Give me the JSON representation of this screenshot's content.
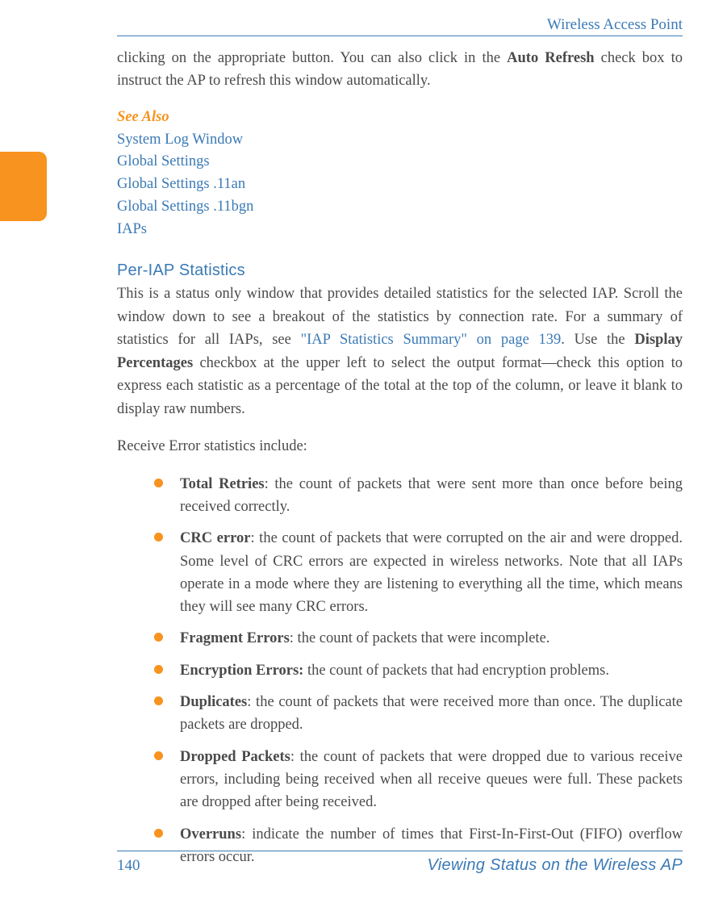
{
  "header": {
    "title": "Wireless Access Point"
  },
  "intro": {
    "text_before_bold": "clicking on the appropriate button. You can also click in the ",
    "bold": "Auto Refresh",
    "text_after_bold": " check box to instruct the AP to refresh this window automatically."
  },
  "see_also": {
    "heading": "See Also",
    "links": [
      "System Log Window",
      "Global Settings",
      "Global Settings .11an",
      "Global Settings .11bgn",
      "IAPs"
    ]
  },
  "section": {
    "heading": "Per-IAP Statistics",
    "para1_before_ref": "This is a status only window that provides detailed statistics for the selected IAP. Scroll the window down to see a breakout of the statistics by connection rate. For a summary of statistics for all IAPs, see ",
    "para1_ref": "\"IAP Statistics Summary\" on page 139",
    "para1_after_ref1": ". Use the ",
    "para1_bold": "Display Percentages",
    "para1_after_ref2": " checkbox at the upper left to select the output format—check this option to express each statistic as a percentage of the total at the top of the column, or leave it blank to display raw numbers.",
    "para2": "Receive Error statistics include:"
  },
  "bullets": [
    {
      "bold": "Total Retries",
      "text": ": the count of packets that were sent more than once before being received correctly."
    },
    {
      "bold": "CRC error",
      "text": ": the count of packets that were corrupted on the air and were dropped. Some level of CRC errors are expected in wireless networks. Note that all IAPs operate in a mode where they are listening to everything all the time, which means they will see many CRC errors."
    },
    {
      "bold": "Fragment Errors",
      "text": ": the count of packets that were incomplete."
    },
    {
      "bold": "Encryption Errors:",
      "text": " the count of packets that had encryption problems."
    },
    {
      "bold": "Duplicates",
      "text": ": the count of packets that were received more than once. The duplicate packets are dropped."
    },
    {
      "bold": "Dropped Packets",
      "text": ": the count of packets that were dropped due to various receive errors, including being received when all receive queues were full. These packets are dropped after being received."
    },
    {
      "bold": "Overruns",
      "text": ": indicate the number of times that First-In-First-Out (FIFO) overflow errors occur."
    }
  ],
  "footer": {
    "page": "140",
    "title": "Viewing Status on the Wireless AP"
  }
}
